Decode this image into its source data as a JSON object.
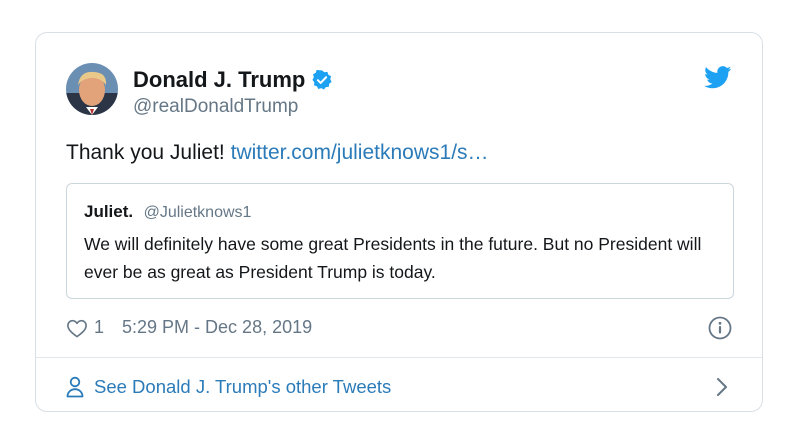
{
  "author": {
    "name": "Donald J. Trump",
    "handle": "@realDonaldTrump",
    "avatar_icon": "avatar-portrait",
    "verified_icon": "verified-badge-icon"
  },
  "tweet": {
    "text": "Thank you Juliet!",
    "link": "twitter.com/julietknows1/s…"
  },
  "quoted": {
    "name": "Juliet.",
    "handle": "@Julietknows1",
    "text": "We will definitely have some great Presidents in the future. But no President will ever be as great as President Trump is today."
  },
  "meta": {
    "likes": "1",
    "timestamp": "5:29 PM - Dec 28, 2019"
  },
  "footer": {
    "label": "See Donald J. Trump's other Tweets"
  },
  "colors": {
    "link": "#2b7bb9",
    "twitter_blue": "#1da1f2",
    "muted": "#657786",
    "text": "#14171a",
    "border": "#d8e0e6"
  }
}
